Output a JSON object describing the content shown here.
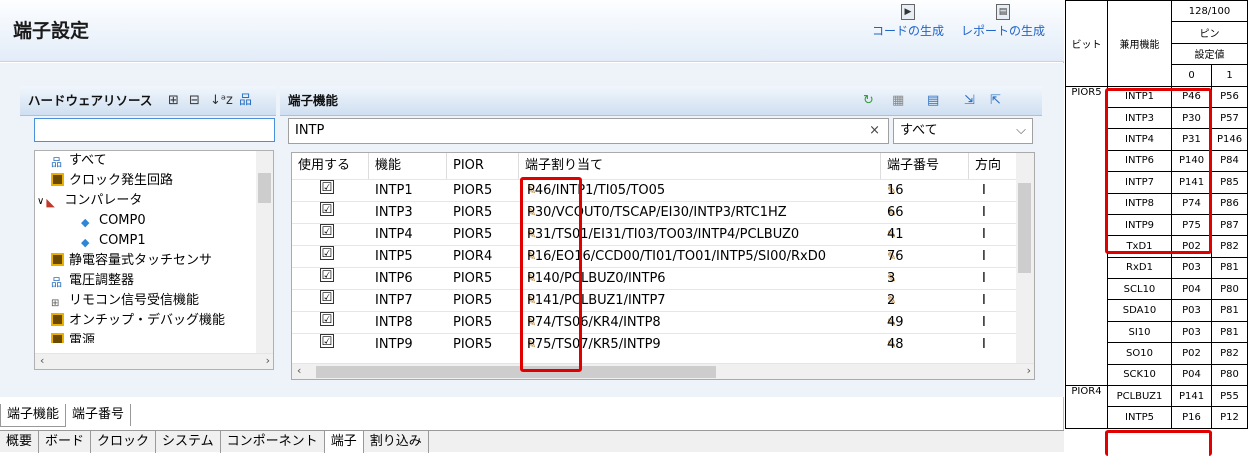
{
  "title": "端子設定",
  "header_buttons": [
    {
      "label": "コードの生成",
      "icon": "code-generate-icon"
    },
    {
      "label": "レポートの生成",
      "icon": "report-generate-icon"
    }
  ],
  "left_panel": {
    "title": "ハードウェアリソース",
    "search_value": "",
    "tree": [
      {
        "label": "すべて",
        "icon": "all-resources-icon"
      },
      {
        "label": "クロック発生回路",
        "icon": "chip-icon"
      },
      {
        "label": "コンパレータ",
        "icon": "comparator-icon",
        "expanded": true
      },
      {
        "label": "COMP0",
        "icon": "dot-icon"
      },
      {
        "label": "COMP1",
        "icon": "dot-icon"
      },
      {
        "label": "静電容量式タッチセンサ",
        "icon": "chip-icon"
      },
      {
        "label": "電圧調整器",
        "icon": "all-resources-icon"
      },
      {
        "label": "リモコン信号受信機能",
        "icon": "remote-icon"
      },
      {
        "label": "オンチップ・デバッグ機能",
        "icon": "chip-icon"
      },
      {
        "label": "電源",
        "icon": "chip-icon"
      }
    ]
  },
  "right_panel": {
    "title": "端子機能",
    "filter_value": "INTP",
    "filter_clear": "×",
    "combo_value": "すべて",
    "columns": [
      "使用する",
      "機能",
      "PIOR",
      "端子割り当て",
      "端子番号",
      "方向"
    ],
    "rows": [
      {
        "use": "☑",
        "func": "INTP1",
        "pior": "PIOR5",
        "assign": "P46/INTP1/TI05/TO05",
        "pin": "16",
        "dir": "I"
      },
      {
        "use": "☑",
        "func": "INTP3",
        "pior": "PIOR5",
        "assign": "P30/VCOUT0/TSCAP/EI30/INTP3/RTC1HZ",
        "pin": "66",
        "dir": "I"
      },
      {
        "use": "☑",
        "func": "INTP4",
        "pior": "PIOR5",
        "assign": "P31/TS01/EI31/TI03/TO03/INTP4/PCLBUZ0",
        "pin": "41",
        "dir": "I"
      },
      {
        "use": "☑",
        "func": "INTP5",
        "pior": "PIOR4",
        "assign": "P16/EO16/CCD00/TI01/TO01/INTP5/SI00/RxD0",
        "pin": "76",
        "dir": "I"
      },
      {
        "use": "☑",
        "func": "INTP6",
        "pior": "PIOR5",
        "assign": "P140/PCLBUZ0/INTP6",
        "pin": "3",
        "dir": "I"
      },
      {
        "use": "☑",
        "func": "INTP7",
        "pior": "PIOR5",
        "assign": "P141/PCLBUZ1/INTP7",
        "pin": "2",
        "dir": "I"
      },
      {
        "use": "☑",
        "func": "INTP8",
        "pior": "PIOR5",
        "assign": "P74/TS06/KR4/INTP8",
        "pin": "49",
        "dir": "I"
      },
      {
        "use": "☑",
        "func": "INTP9",
        "pior": "PIOR5",
        "assign": "P75/TS07/KR5/INTP9",
        "pin": "48",
        "dir": "I"
      }
    ]
  },
  "bottom_tabs_1": [
    "端子機能",
    "端子番号"
  ],
  "bottom_tabs_2": [
    "概要",
    "ボード",
    "クロック",
    "システム",
    "コンポーネント",
    "端子",
    "割り込み"
  ],
  "spec_table": {
    "headers": {
      "bit": "ビット",
      "func": "兼用機能",
      "pin_count": "128/100",
      "pin": "ピン",
      "setting": "設定値",
      "v0": "0",
      "v1": "1"
    },
    "rows": [
      {
        "bit": "PIOR5",
        "func": "INTP1",
        "v0": "P46",
        "v1": "P56"
      },
      {
        "bit": "",
        "func": "INTP3",
        "v0": "P30",
        "v1": "P57"
      },
      {
        "bit": "",
        "func": "INTP4",
        "v0": "P31",
        "v1": "P146"
      },
      {
        "bit": "",
        "func": "INTP6",
        "v0": "P140",
        "v1": "P84"
      },
      {
        "bit": "",
        "func": "INTP7",
        "v0": "P141",
        "v1": "P85"
      },
      {
        "bit": "",
        "func": "INTP8",
        "v0": "P74",
        "v1": "P86"
      },
      {
        "bit": "",
        "func": "INTP9",
        "v0": "P75",
        "v1": "P87"
      },
      {
        "bit": "",
        "func": "TxD1",
        "v0": "P02",
        "v1": "P82"
      },
      {
        "bit": "",
        "func": "RxD1",
        "v0": "P03",
        "v1": "P81"
      },
      {
        "bit": "",
        "func": "SCL10",
        "v0": "P04",
        "v1": "P80"
      },
      {
        "bit": "",
        "func": "SDA10",
        "v0": "P03",
        "v1": "P81"
      },
      {
        "bit": "",
        "func": "SI10",
        "v0": "P03",
        "v1": "P81"
      },
      {
        "bit": "",
        "func": "SO10",
        "v0": "P02",
        "v1": "P82"
      },
      {
        "bit": "",
        "func": "SCK10",
        "v0": "P04",
        "v1": "P80"
      },
      {
        "bit": "PIOR4",
        "func": "PCLBUZ1",
        "v0": "P141",
        "v1": "P55"
      },
      {
        "bit": "",
        "func": "INTP5",
        "v0": "P16",
        "v1": "P12"
      }
    ]
  }
}
